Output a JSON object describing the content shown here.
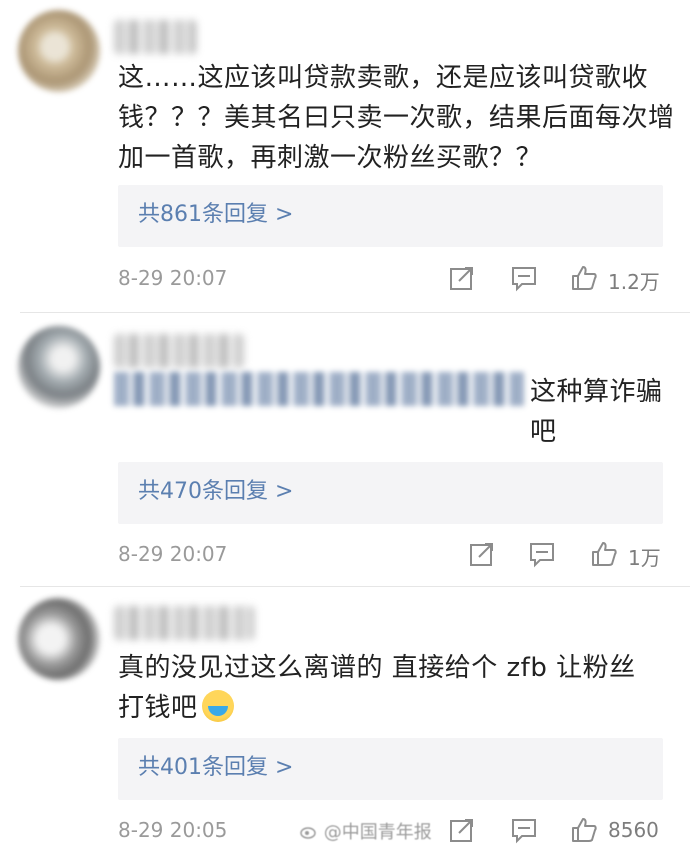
{
  "comments": [
    {
      "text": "这……这应该叫贷款卖歌，还是应该叫贷歌收钱？？？美其名曰只卖一次歌，结果后面每次增加一首歌，再刺激一次粉丝买歌？？",
      "replies": "共861条回复 >",
      "time": "8-29 20:07",
      "likes": "1.2万"
    },
    {
      "text": "这种算诈骗吧",
      "replies": "共470条回复 >",
      "time": "8-29 20:07",
      "likes": "1万"
    },
    {
      "text": "真的没见过这么离谱的 直接给个 zfb 让粉丝打钱吧",
      "replies": "共401条回复 >",
      "time": "8-29 20:05",
      "likes": "8560"
    }
  ],
  "watermark": "@中国青年报",
  "icons": [
    "share-icon",
    "comment-icon",
    "like-icon",
    "weibo-icon",
    "crying-emoji"
  ]
}
